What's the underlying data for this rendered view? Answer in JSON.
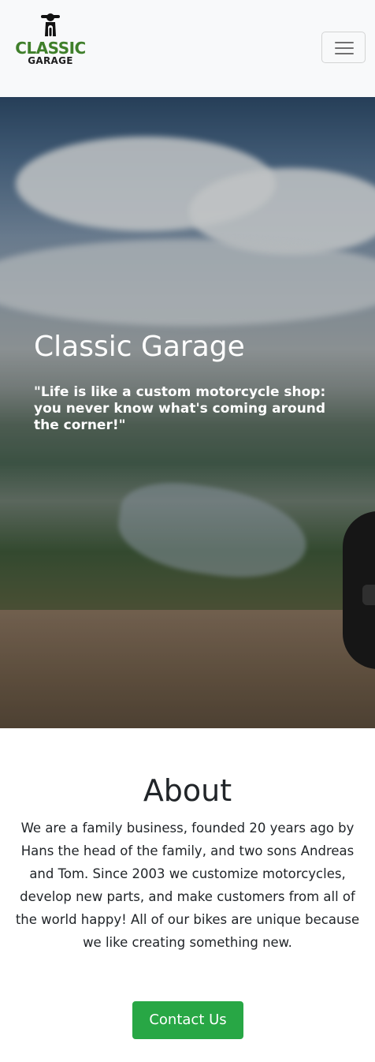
{
  "navbar": {
    "logo": {
      "line1": "CLASSIC",
      "line2": "GARAGE",
      "icon": "motorcycle-rider-icon"
    },
    "toggler_icon": "hamburger-menu-icon"
  },
  "hero": {
    "title": "Classic Garage",
    "quote": "\"Life is like a custom motorcycle shop: you never know what's coming around the corner!\""
  },
  "about": {
    "heading": "About",
    "text": "We are a family business, founded 20 years ago by Hans the head of the family, and two sons Andreas and Tom. Since 2003 we customize motorcycles, develop new parts, and make customers from all of the world happy! All of our bikes are unique because we like creating something new.",
    "contact_label": "Contact Us"
  },
  "colors": {
    "navbar_bg": "#f8f9fa",
    "logo_green": "#3f7f2a",
    "button_green": "#28a745",
    "text_dark": "#212529"
  }
}
